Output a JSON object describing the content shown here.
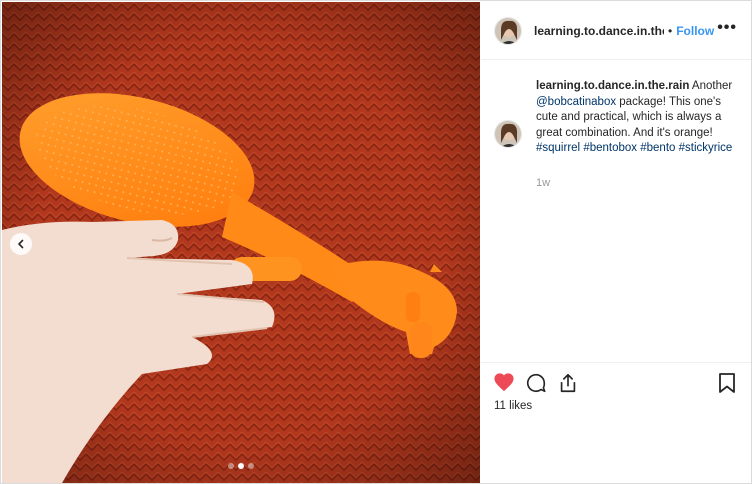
{
  "post": {
    "author": {
      "username": "learning.to.dance.in.the.ra",
      "follow_label": "Follow",
      "separator": "•",
      "more_label": "•••"
    },
    "caption": {
      "username": "learning.to.dance.in.the.rain",
      "text_1": " Another ",
      "mention": "@bobcatinabox",
      "text_2": " package! This one's cute and practical, which is always a great combination. And it's orange! ",
      "hashtags": [
        "#squirrel",
        "#bentobox",
        "#bento",
        "#stickyrice"
      ],
      "time": "1w"
    },
    "engagement": {
      "likes": "11 likes",
      "liked": true
    },
    "carousel": {
      "slide_count": 3,
      "active_index": 1
    },
    "colors": {
      "accent": "#3897f0",
      "link": "#003569",
      "like_red": "#ed4956",
      "muted": "#999999"
    },
    "icons": [
      "heart-icon",
      "comment-icon",
      "share-icon",
      "bookmark-icon",
      "chevron-left-icon",
      "more-icon"
    ]
  }
}
